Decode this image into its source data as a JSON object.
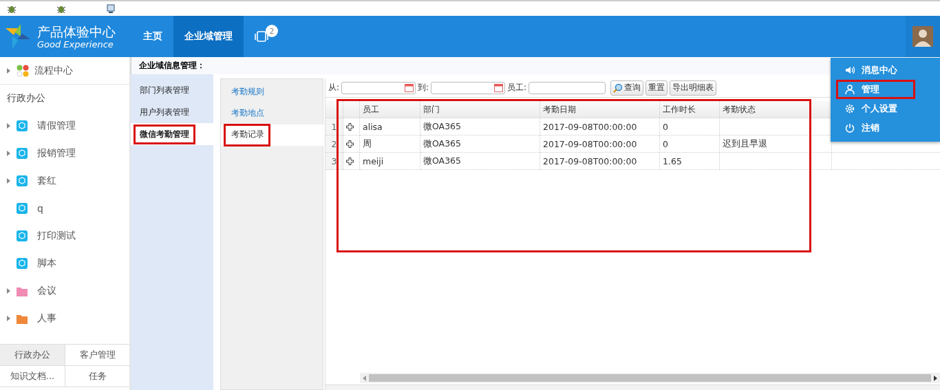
{
  "header": {
    "logo_title": "产品体验中心",
    "logo_subtitle": "Good Experience",
    "nav": [
      {
        "kind": "text",
        "label": "主页",
        "selected": false
      },
      {
        "kind": "text",
        "label": "企业域管理",
        "selected": true
      },
      {
        "kind": "devices",
        "badge": "2",
        "selected": false
      }
    ]
  },
  "sidebar": {
    "top_item": {
      "label": "流程中心",
      "expandable": true
    },
    "section": "行政办公",
    "items": [
      {
        "label": "请假管理",
        "kind": "module",
        "expandable": true
      },
      {
        "label": "报销管理",
        "kind": "module",
        "expandable": true
      },
      {
        "label": "套红",
        "kind": "module",
        "expandable": true
      },
      {
        "label": "q",
        "kind": "module",
        "expandable": false
      },
      {
        "label": "打印测试",
        "kind": "module",
        "expandable": false
      },
      {
        "label": "脚本",
        "kind": "module",
        "expandable": false
      },
      {
        "label": "会议",
        "kind": "folder",
        "color": "#f08cb4",
        "expandable": true
      },
      {
        "label": "人事",
        "kind": "folder",
        "color": "#f0883a",
        "expandable": true
      }
    ],
    "bottom_tabs": [
      {
        "label": "行政办公",
        "selected": true
      },
      {
        "label": "客户管理",
        "selected": false
      },
      {
        "label": "知识文档...",
        "selected": false
      },
      {
        "label": "任务",
        "selected": false
      }
    ]
  },
  "panel_title": "企业域信息管理：",
  "menu": [
    {
      "label": "部门列表管理",
      "selected": false,
      "highlighted": false
    },
    {
      "label": "用户列表管理",
      "selected": false,
      "highlighted": false
    },
    {
      "label": "微信考勤管理",
      "selected": true,
      "highlighted": true
    }
  ],
  "subtabs": [
    {
      "label": "考勤规则",
      "selected": false,
      "highlighted": false
    },
    {
      "label": "考勤地点",
      "selected": false,
      "highlighted": false
    },
    {
      "label": "考勤记录",
      "selected": true,
      "highlighted": true
    }
  ],
  "toolbar": {
    "from_label": "从:",
    "to_label": "到:",
    "employee_label": "员工:",
    "buttons": [
      {
        "label": "查询",
        "kind": "search"
      },
      {
        "label": "重置",
        "kind": "plain"
      },
      {
        "label": "导出明细表",
        "kind": "plain"
      }
    ]
  },
  "table": {
    "highlighted": true,
    "columns": [
      "员工",
      "部门",
      "考勤日期",
      "工作时长",
      "考勤状态"
    ],
    "rows": [
      {
        "number": "1",
        "employee": "alisa",
        "department": "微OA365",
        "date": "2017-09-08T00:00:00",
        "hours": "0",
        "status": ""
      },
      {
        "number": "2",
        "employee": "周",
        "department": "微OA365",
        "date": "2017-09-08T00:00:00",
        "hours": "0",
        "status": "迟到且早退"
      },
      {
        "number": "3",
        "employee": "meiji",
        "department": "微OA365",
        "date": "2017-09-08T00:00:00",
        "hours": "1.65",
        "status": ""
      }
    ]
  },
  "user_menu": [
    {
      "label": "消息中心",
      "kind": "speaker",
      "highlighted": false
    },
    {
      "label": "管理",
      "kind": "user",
      "highlighted": true
    },
    {
      "label": "个人设置",
      "kind": "gear",
      "highlighted": false
    },
    {
      "label": "注销",
      "kind": "power",
      "highlighted": false
    }
  ]
}
